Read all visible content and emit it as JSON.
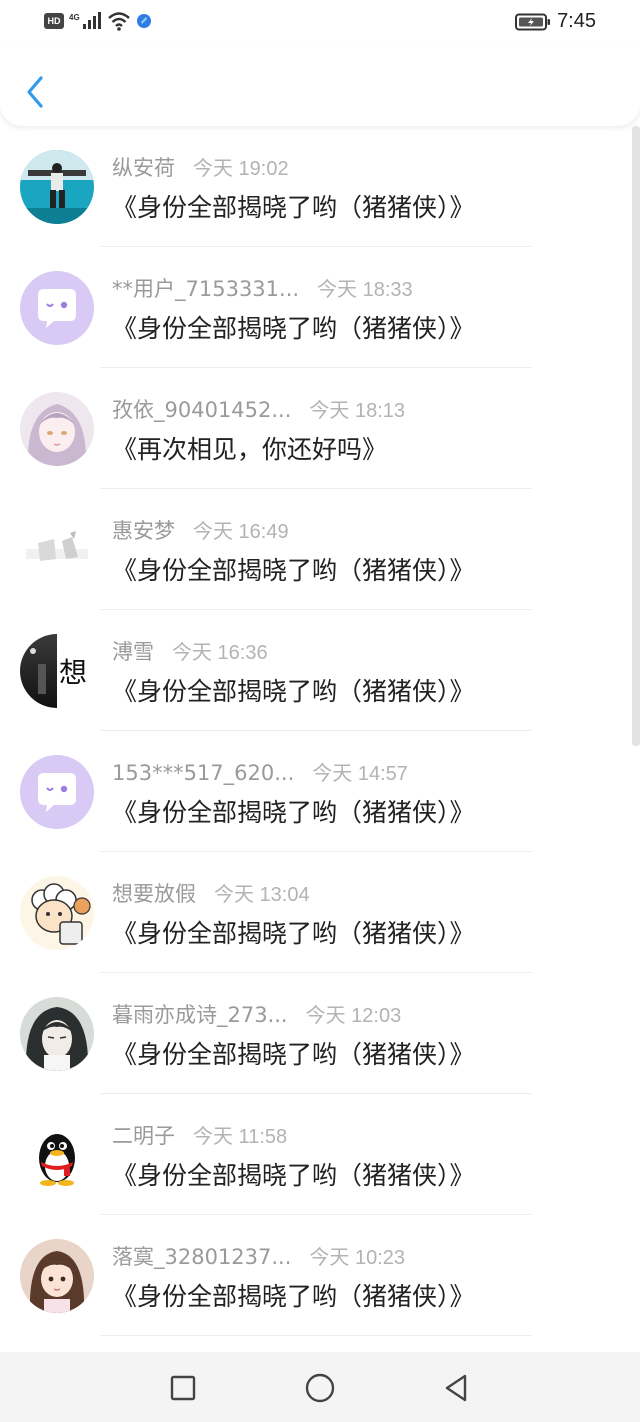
{
  "status_bar": {
    "hd": "HD",
    "network": "4G",
    "time": "7:45",
    "icons": [
      "hd-icon",
      "signal-icon",
      "wifi-icon",
      "app-notification-icon",
      "battery-charging-icon"
    ]
  },
  "header": {
    "back_icon": "chevron-left-icon",
    "accent": "#2f9bea"
  },
  "messages": [
    {
      "name": "纵安荷",
      "time": "今天 19:02",
      "text": "《身份全部揭晓了哟（猪猪侠）》"
    },
    {
      "name": "**用户_7153331...",
      "time": "今天 18:33",
      "text": "《身份全部揭晓了哟（猪猪侠）》"
    },
    {
      "name": "孜依_90401452...",
      "time": "今天 18:13",
      "text": "《再次相见，你还好吗》"
    },
    {
      "name": "惠安梦",
      "time": "今天 16:49",
      "text": "《身份全部揭晓了哟（猪猪侠）》"
    },
    {
      "name": "溥雪",
      "time": "今天 16:36",
      "text": "《身份全部揭晓了哟（猪猪侠）》",
      "avatar_char": "想"
    },
    {
      "name": "153***517_620...",
      "time": "今天 14:57",
      "text": "《身份全部揭晓了哟（猪猪侠）》"
    },
    {
      "name": "想要放假",
      "time": "今天 13:04",
      "text": "《身份全部揭晓了哟（猪猪侠）》"
    },
    {
      "name": "暮雨亦成诗_273...",
      "time": "今天 12:03",
      "text": "《身份全部揭晓了哟（猪猪侠）》"
    },
    {
      "name": "二明子",
      "time": "今天 11:58",
      "text": "《身份全部揭晓了哟（猪猪侠）》"
    },
    {
      "name": "落寞_32801237...",
      "time": "今天 10:23",
      "text": "《身份全部揭晓了哟（猪猪侠）》"
    }
  ],
  "nav": {
    "recents_icon": "square-icon",
    "home_icon": "circle-icon",
    "back_icon": "triangle-back-icon"
  }
}
